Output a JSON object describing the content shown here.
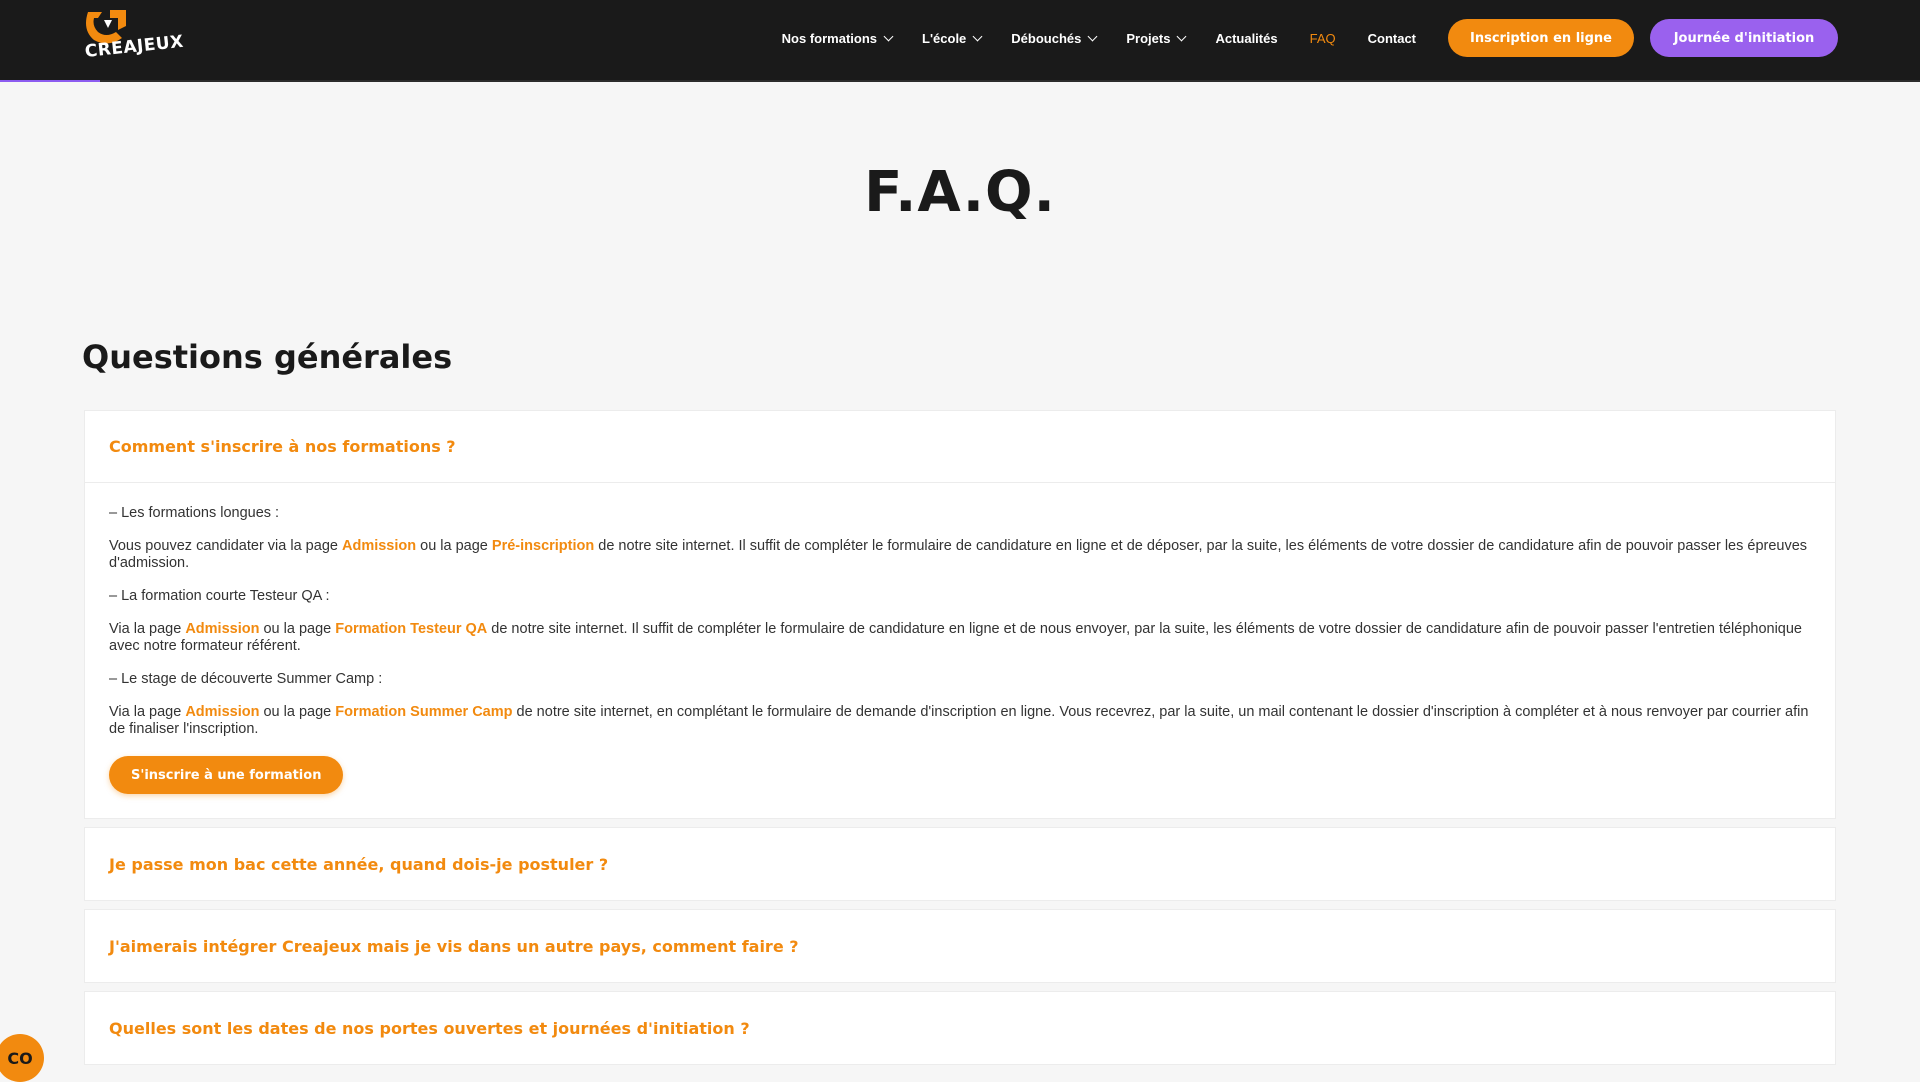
{
  "header": {
    "logo_text": "CREAJEUX",
    "nav": [
      {
        "label": "Nos formations",
        "has_dropdown": true
      },
      {
        "label": "L'école",
        "has_dropdown": true
      },
      {
        "label": "Débouchés",
        "has_dropdown": true
      },
      {
        "label": "Projets",
        "has_dropdown": true
      },
      {
        "label": "Actualités",
        "has_dropdown": false
      },
      {
        "label": "FAQ",
        "has_dropdown": false,
        "active": true
      },
      {
        "label": "Contact",
        "has_dropdown": false
      }
    ],
    "btn_inscription": "Inscription en ligne",
    "btn_journee": "Journée d'initiation"
  },
  "main": {
    "page_title": "F.A.Q.",
    "section_title": "Questions générales",
    "faq": [
      {
        "question": "Comment s'inscrire à nos formations ?",
        "open": true,
        "answer": {
          "p1_head": "– Les formations longues :",
          "p1_pre": "Vous pouvez candidater via la page ",
          "p1_link1": "Admission",
          "p1_mid": " ou la page ",
          "p1_link2": "Pré-inscription",
          "p1_post": " de notre site internet. Il suffit de compléter le formulaire de candidature en ligne et de déposer, par la suite, les éléments de votre dossier de candidature afin de pouvoir passer les épreuves d'admission.",
          "p2_head": "– La formation courte Testeur QA :",
          "p2_pre": "Via la page ",
          "p2_link1": "Admission",
          "p2_mid": " ou la page ",
          "p2_link2": "Formation Testeur QA",
          "p2_post": " de notre site internet. Il suffit de compléter le formulaire de candidature en ligne et de nous envoyer, par la suite, les éléments de votre dossier de candidature afin de pouvoir passer l'entretien téléphonique avec notre formateur référent.",
          "p3_head": "– Le stage de découverte Summer Camp :",
          "p3_pre": "Via la page ",
          "p3_link1": "Admission",
          "p3_mid": " ou la page ",
          "p3_link2": "Formation Summer Camp",
          "p3_post": " de notre site internet, en complétant le formulaire de demande d'inscription en ligne. Vous recevrez, par la suite, un mail contenant le dossier d'inscription à compléter et à nous renvoyer par courrier afin de finaliser l'inscription.",
          "cta": "S'inscrire à une formation"
        }
      },
      {
        "question": "Je passe mon bac cette année, quand dois-je postuler ?",
        "open": false
      },
      {
        "question": "J'aimerais intégrer Creajeux mais je vis dans un autre pays, comment faire ?",
        "open": false
      },
      {
        "question": "Quelles sont les dates de nos portes ouvertes et journées d'initiation ?",
        "open": false
      }
    ]
  },
  "widget": {
    "label": "CO"
  },
  "colors": {
    "accent": "#f28a0f",
    "purple": "#9a61ee",
    "header_bg": "#1a1a1a",
    "page_bg": "#f6f6f6"
  }
}
